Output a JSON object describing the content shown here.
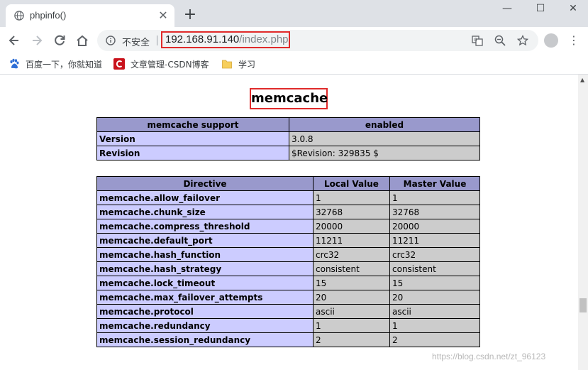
{
  "browser": {
    "tab_title": "phpinfo()",
    "tab_close_glyph": "✕",
    "new_tab_glyph": "+",
    "window_minimize_glyph": "—",
    "window_maximize_glyph": "☐",
    "window_close_glyph": "✕",
    "security_label": "不安全",
    "url_host": "192.168.91.140",
    "url_path": "/index.php",
    "menu_glyph": "⋮",
    "icons": {
      "back": "arrow-left-icon",
      "forward": "arrow-right-icon",
      "reload": "reload-icon",
      "home": "home-icon",
      "info": "info-icon",
      "translate": "translate-icon",
      "zoom": "zoom-out-icon",
      "bookmark": "star-icon",
      "profile": "avatar-icon"
    }
  },
  "bookmarks": [
    {
      "label": "百度一下，你就知道",
      "icon": "baidu-paw-icon"
    },
    {
      "label": "文章管理-CSDN博客",
      "icon": "csdn-logo-icon"
    },
    {
      "label": "学习",
      "icon": "folder-icon"
    }
  ],
  "page": {
    "section_title": "memcache",
    "support_table": {
      "headers": [
        "memcache support",
        "enabled"
      ],
      "rows": [
        [
          "Version",
          "3.0.8"
        ],
        [
          "Revision",
          "$Revision: 329835 $"
        ]
      ]
    },
    "directive_table": {
      "headers": [
        "Directive",
        "Local Value",
        "Master Value"
      ],
      "rows": [
        [
          "memcache.allow_failover",
          "1",
          "1"
        ],
        [
          "memcache.chunk_size",
          "32768",
          "32768"
        ],
        [
          "memcache.compress_threshold",
          "20000",
          "20000"
        ],
        [
          "memcache.default_port",
          "11211",
          "11211"
        ],
        [
          "memcache.hash_function",
          "crc32",
          "crc32"
        ],
        [
          "memcache.hash_strategy",
          "consistent",
          "consistent"
        ],
        [
          "memcache.lock_timeout",
          "15",
          "15"
        ],
        [
          "memcache.max_failover_attempts",
          "20",
          "20"
        ],
        [
          "memcache.protocol",
          "ascii",
          "ascii"
        ],
        [
          "memcache.redundancy",
          "1",
          "1"
        ],
        [
          "memcache.session_redundancy",
          "2",
          "2"
        ]
      ]
    },
    "watermark": "https://blog.csdn.net/zt_96123"
  },
  "colors": {
    "header_bg": "#9999cc",
    "key_bg": "#ccccff",
    "value_bg": "#cccccc",
    "highlight": "#e02b2b"
  }
}
